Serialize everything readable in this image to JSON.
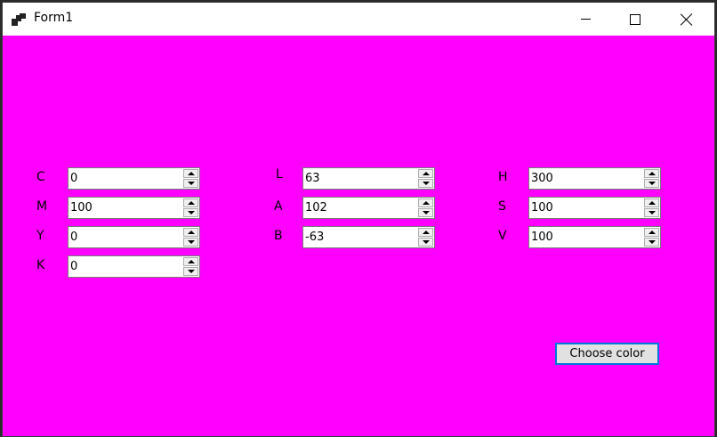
{
  "window": {
    "title": "Form1",
    "background": "#ff00ff"
  },
  "cmyk": {
    "c": {
      "label": "C",
      "value": "0"
    },
    "m": {
      "label": "M",
      "value": "100"
    },
    "y": {
      "label": "Y",
      "value": "0"
    },
    "k": {
      "label": "K",
      "value": "0"
    }
  },
  "lab": {
    "l": {
      "label": "L",
      "value": "63"
    },
    "a": {
      "label": "A",
      "value": "102"
    },
    "b": {
      "label": "B",
      "value": "-63"
    }
  },
  "hsv": {
    "h": {
      "label": "H",
      "value": "300"
    },
    "s": {
      "label": "S",
      "value": "100"
    },
    "v": {
      "label": "V",
      "value": "100"
    }
  },
  "choose_button": {
    "label": "Choose color",
    "border_color": "#0078d7"
  },
  "icons": [
    "app-icon",
    "minimize-icon",
    "maximize-icon",
    "close-icon",
    "spin-up-icon",
    "spin-down-icon"
  ]
}
